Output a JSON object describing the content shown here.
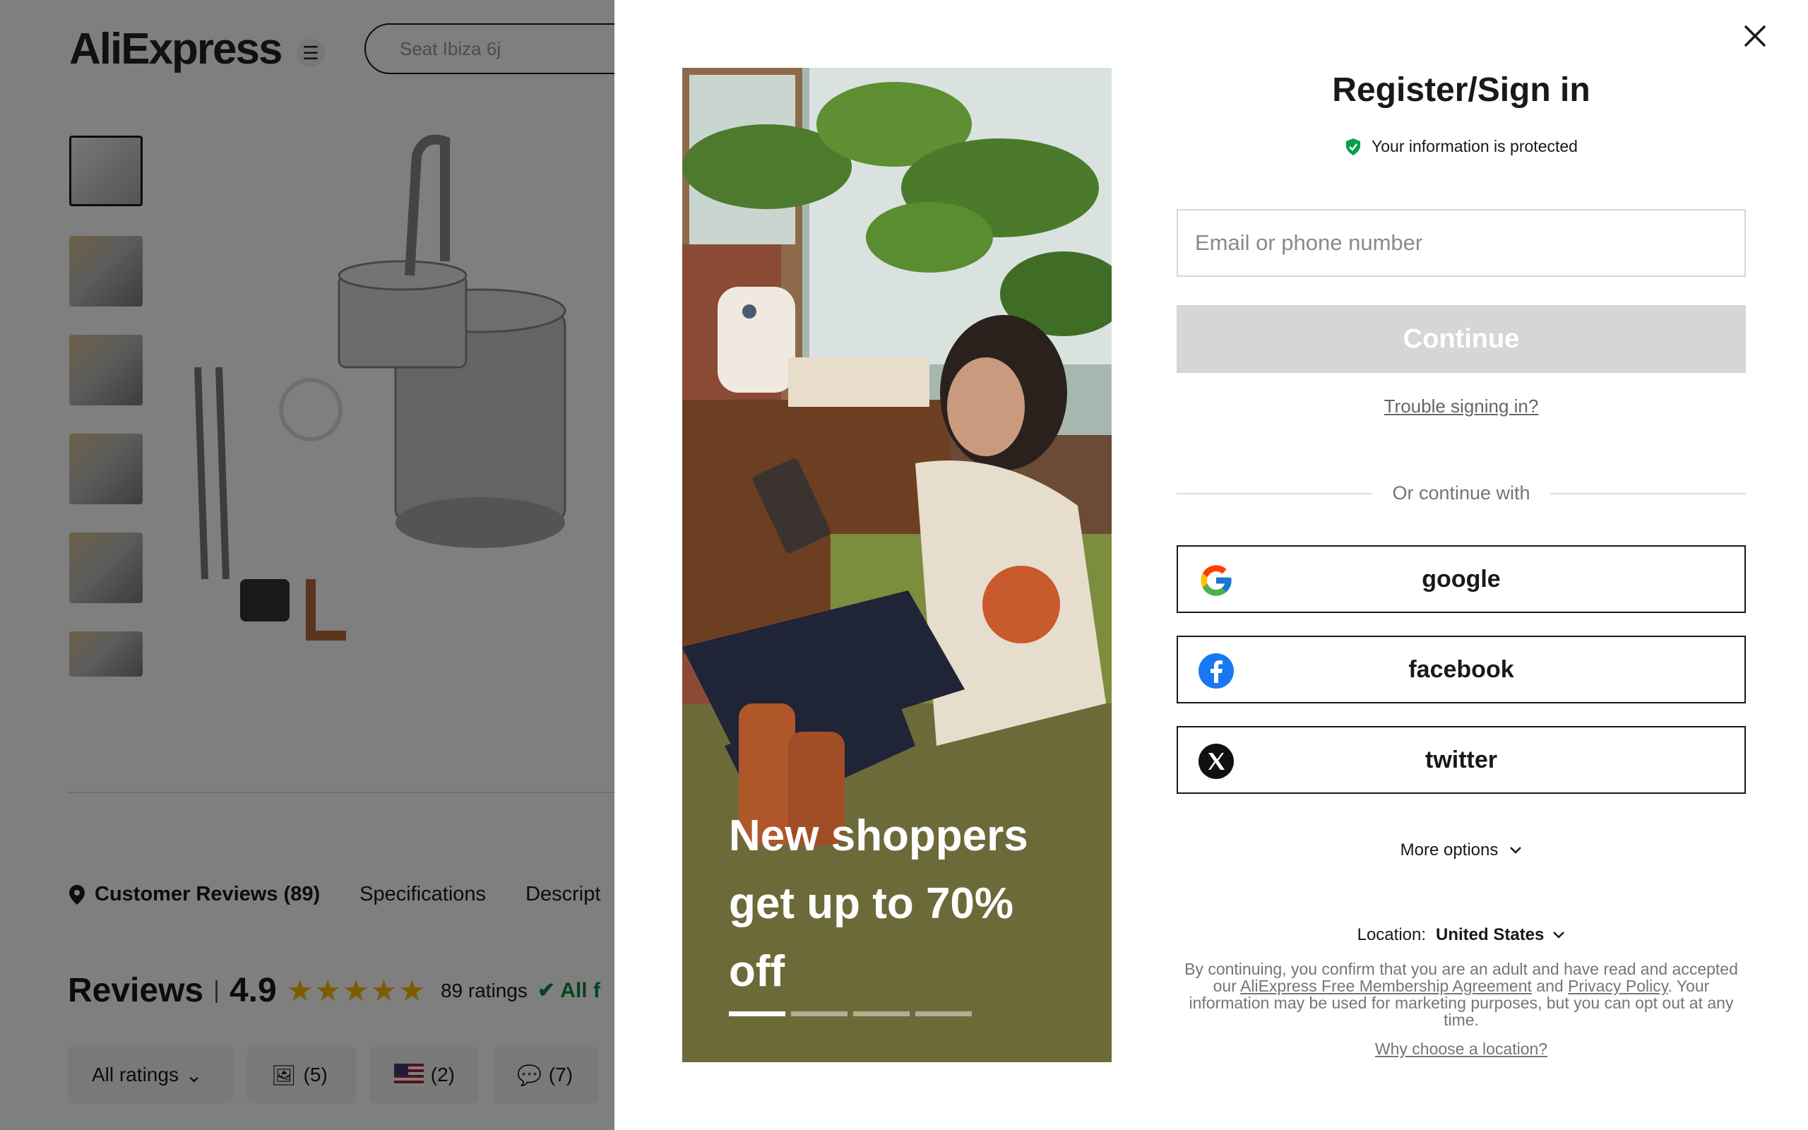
{
  "background": {
    "logo": "AliExpress",
    "search_placeholder": "Seat Ibiza 6j",
    "tabs": {
      "reviews": "Customer Reviews (89)",
      "specifications": "Specifications",
      "description": "Descript"
    },
    "reviews": {
      "title": "Reviews",
      "separator": "|",
      "score": "4.9",
      "ratings": "89 ratings",
      "all_filter": "All f"
    },
    "filters": {
      "all_ratings": "All ratings",
      "photos": "(5)",
      "country": "(2)",
      "comments": "(7)"
    }
  },
  "modal": {
    "promo": {
      "headline": "New shoppers get up to 70% off",
      "slides": 4,
      "active_slide": 1
    },
    "title": "Register/Sign in",
    "protected_text": "Your information is protected",
    "email_placeholder": "Email or phone number",
    "continue_label": "Continue",
    "trouble_link": "Trouble signing in?",
    "or_text": "Or continue with",
    "social": {
      "google": "google",
      "facebook": "facebook",
      "twitter": "twitter"
    },
    "more_options": "More options",
    "location_label": "Location:",
    "location_value": "United States",
    "legal": {
      "part1": "By continuing, you confirm that you are an adult and have read and accepted our",
      "agreement_link": "AliExpress Free Membership Agreement",
      "and": "and",
      "privacy_link": "Privacy Policy",
      "part2": ". Your information may be used for marketing purposes, but you can opt out at any time."
    },
    "why_location": "Why choose a location?"
  },
  "colors": {
    "brand_red": "#e43225",
    "protected_green": "#06a04b",
    "star_yellow": "#fdb600",
    "facebook_blue": "#1877f2"
  }
}
